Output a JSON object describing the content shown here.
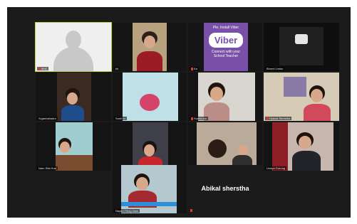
{
  "meeting": {
    "participants": [
      {
        "name": "Mo6",
        "type": "placeholder"
      },
      {
        "name": "bit",
        "type": "video"
      },
      {
        "name": "Ka",
        "type": "viber_card"
      },
      {
        "name": "Bhumi Limbu",
        "type": "video"
      },
      {
        "name": "Sujanbahadur",
        "type": "video"
      },
      {
        "name": "Sunil ro",
        "type": "video"
      },
      {
        "name": "Sudha shr",
        "type": "video"
      },
      {
        "name": "Hyaval Shrestha",
        "type": "video"
      },
      {
        "name": "Nam Sita Hue",
        "type": "video"
      },
      {
        "name": "Sujas mate",
        "type": "video"
      },
      {
        "name": "Hamila",
        "type": "video"
      },
      {
        "name": "Unaya Gurung",
        "type": "video"
      },
      {
        "name": "Nayen Thing Nam",
        "type": "video"
      },
      {
        "name": "",
        "type": "name_only",
        "display_name": "Abikal sherstha"
      }
    ],
    "viber_card": {
      "top_text": "Ple, Install Viber",
      "logo_text": "Viber",
      "subtitle": "Connect with your School Teacher"
    },
    "colors": {
      "background": "#1b1b1b",
      "active_speaker_border": "#c8d23a",
      "muted_icon": "#e23a2e",
      "viber_purple": "#7a4fa7"
    }
  }
}
